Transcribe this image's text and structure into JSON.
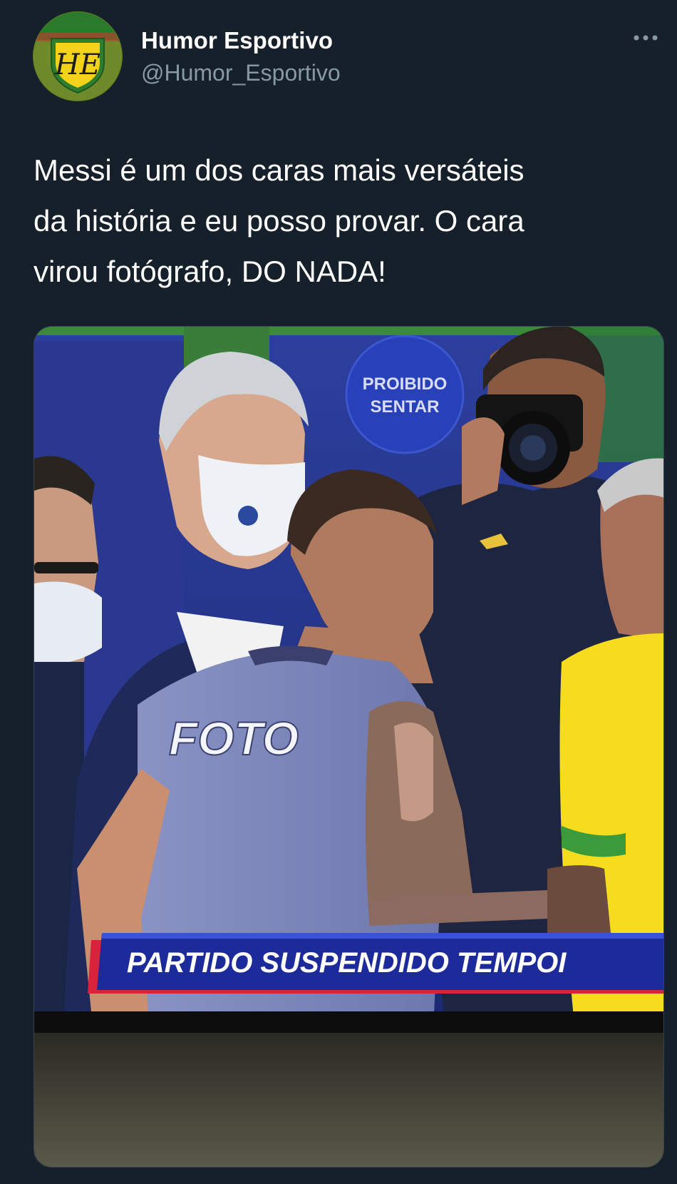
{
  "tweet": {
    "author": {
      "display_name": "Humor Esportivo",
      "handle": "@Humor_Esportivo",
      "avatar_icon": "humor-esportivo-shield-logo",
      "avatar_monogram": "HE"
    },
    "more_icon": "more-dots-icon",
    "text_lines": [
      "Messi é um dos caras mais versáteis",
      "da história e eu posso provar. O cara",
      "virou fotógrafo, DO NADA!"
    ],
    "media": {
      "sign_text": [
        "PROIBIDO",
        "SENTAR"
      ],
      "vest_text": "FOTO",
      "banner_text": "PARTIDO SUSPENDIDO TEMPOI"
    }
  },
  "colors": {
    "background": "#15202b",
    "text_primary": "#ffffff",
    "text_secondary": "#8899a6",
    "border": "#38444d",
    "avatar_yellow": "#f2d31a",
    "avatar_green": "#3d8d2b"
  }
}
